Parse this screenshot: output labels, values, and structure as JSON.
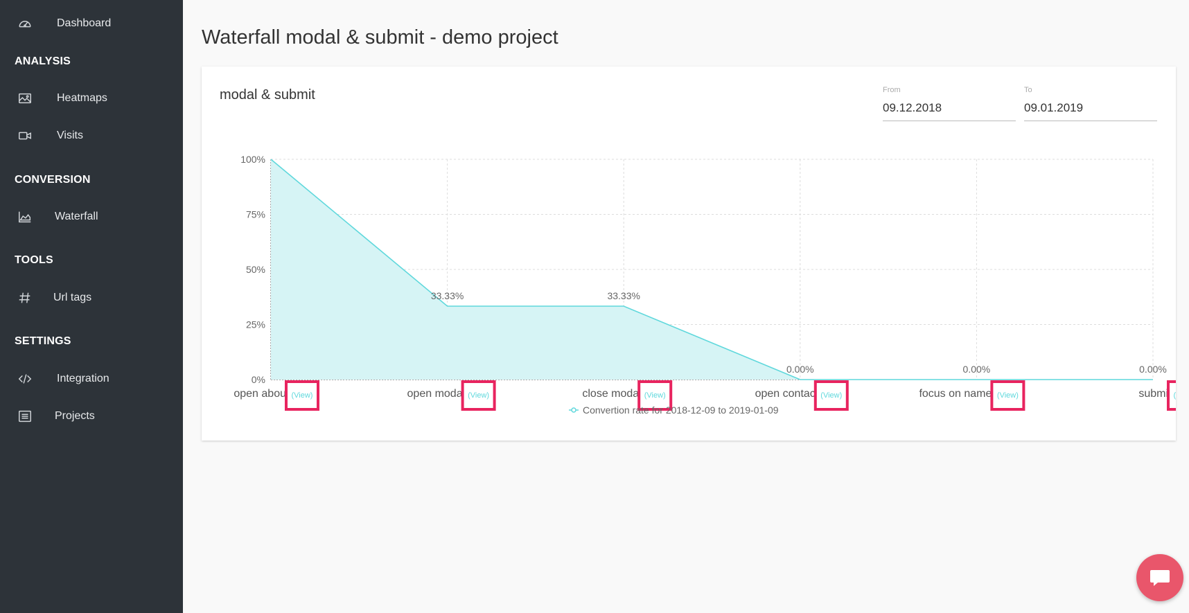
{
  "sidebar": {
    "dashboard": "Dashboard",
    "sections": {
      "analysis": "ANALYSIS",
      "conversion": "CONVERSION",
      "tools": "TOOLS",
      "settings": "SETTINGS"
    },
    "items": {
      "heatmaps": "Heatmaps",
      "visits": "Visits",
      "waterfall": "Waterfall",
      "url_tags": "Url tags",
      "integration": "Integration",
      "projects": "Projects"
    }
  },
  "page": {
    "title": "Waterfall modal & submit - demo project"
  },
  "card": {
    "title": "modal & submit",
    "from_label": "From",
    "from_value": "09.12.2018",
    "to_label": "To",
    "to_value": "09.01.2019"
  },
  "colors": {
    "sidebar_bg": "#2d3339",
    "series": "#5fd8dc",
    "series_fill": "#d6f4f5",
    "highlight": "#e8245f",
    "chat_button": "#e9566b"
  },
  "icons": {
    "dashboard": "speedometer-icon",
    "heatmaps": "image-icon",
    "visits": "video-camera-icon",
    "waterfall": "area-chart-icon",
    "url_tags": "hash-icon",
    "integration": "code-icon",
    "projects": "list-icon",
    "chat": "chat-bubble-icon"
  },
  "chart_data": {
    "type": "area",
    "categories": [
      "open about",
      "open modal",
      "close modal",
      "open contact",
      "focus on name",
      "submit"
    ],
    "category_display": [
      "open abou",
      "open moda",
      "close moda",
      "open contac",
      "focus on name",
      "submi"
    ],
    "view_label": "(View)",
    "series": [
      {
        "name": "Convertion rate for 2018-12-09 to 2019-01-09",
        "values": [
          100,
          33.33,
          33.33,
          0,
          0,
          0
        ]
      }
    ],
    "data_labels": [
      "",
      "33.33%",
      "33.33%",
      "0.00%",
      "0.00%",
      "0.00%"
    ],
    "yticks": [
      "0%",
      "25%",
      "50%",
      "75%",
      "100%"
    ],
    "ylim": [
      0,
      100
    ],
    "grid": true,
    "legend_position": "bottom"
  }
}
